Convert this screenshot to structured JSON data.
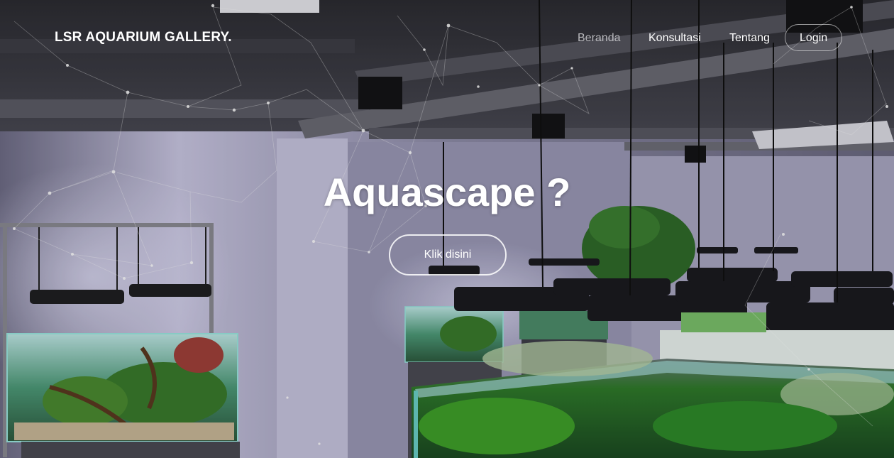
{
  "brand": {
    "name": "LSR AQUARIUM GALLERY."
  },
  "nav": {
    "items": [
      {
        "label": "Beranda",
        "active": true
      },
      {
        "label": "Konsultasi",
        "active": false
      },
      {
        "label": "Tentang",
        "active": false
      }
    ],
    "login_label": "Login"
  },
  "hero": {
    "title": "Aquascape ?",
    "cta_label": "Klik disini"
  },
  "colors": {
    "nav_active": "#b9b9bd",
    "text": "#ffffff",
    "wall": "#b4b2cf",
    "plant_green": "#3fa02a"
  }
}
